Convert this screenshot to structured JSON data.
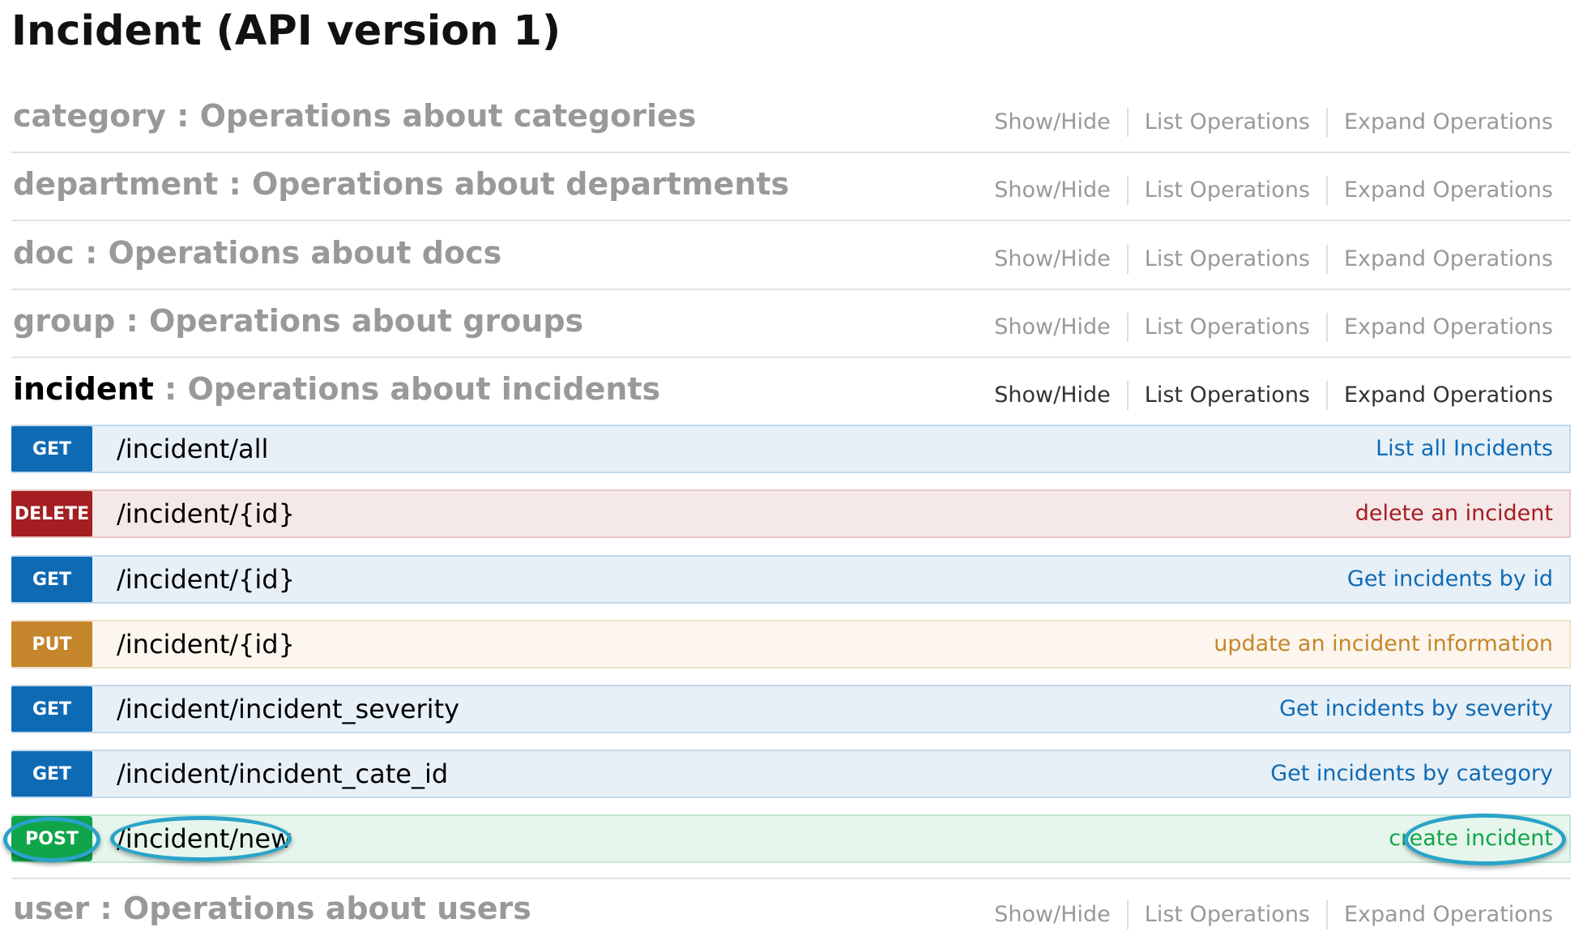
{
  "page": {
    "title": "Incident (API version 1)"
  },
  "link_labels": {
    "show_hide": "Show/Hide",
    "list_operations": "List Operations",
    "expand_operations": "Expand Operations"
  },
  "resources": [
    {
      "name": "category",
      "separator": " : ",
      "description": "Operations about categories"
    },
    {
      "name": "department",
      "separator": " : ",
      "description": "Operations about departments"
    },
    {
      "name": "doc",
      "separator": " : ",
      "description": "Operations about docs"
    },
    {
      "name": "group",
      "separator": " : ",
      "description": "Operations about groups"
    },
    {
      "name": "incident",
      "separator": " : ",
      "description": "Operations about incidents"
    },
    {
      "name": "user",
      "separator": " : ",
      "description": "Operations about users"
    }
  ],
  "operations": [
    {
      "method": "GET",
      "path": "/incident/all",
      "summary": "List all Incidents"
    },
    {
      "method": "DELETE",
      "path": "/incident/{id}",
      "summary": "delete an incident"
    },
    {
      "method": "GET",
      "path": "/incident/{id}",
      "summary": "Get incidents by id"
    },
    {
      "method": "PUT",
      "path": "/incident/{id}",
      "summary": "update an incident information"
    },
    {
      "method": "GET",
      "path": "/incident/incident_severity",
      "summary": "Get incidents by severity"
    },
    {
      "method": "GET",
      "path": "/incident/incident_cate_id",
      "summary": "Get incidents by category"
    },
    {
      "method": "POST",
      "path": "/incident/new",
      "summary": "create incident"
    }
  ],
  "colors": {
    "get": "#0f6ab4",
    "delete": "#a41e22",
    "put": "#c5862b",
    "post": "#10a54a",
    "highlight_circle": "#2aa3c9"
  }
}
